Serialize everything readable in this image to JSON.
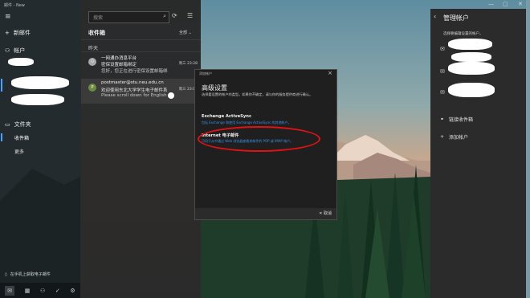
{
  "app": {
    "title": "邮件 - New"
  },
  "sidebar": {
    "menu_icon": "≡",
    "new_mail_label": "新邮件",
    "accounts_label": "帐户",
    "folders_label": "文件夹",
    "inbox_label": "收件箱",
    "more_label": "更多",
    "bottom_message": "在手机上获取电子邮件",
    "bottom_icons": [
      "mail-icon",
      "calendar-icon",
      "people-icon",
      "todo-icon",
      "settings-icon"
    ]
  },
  "message_list": {
    "search_placeholder": "搜索",
    "folder_title": "收件箱",
    "filter_label": "全部",
    "group_label": "昨天",
    "messages": [
      {
        "sender": "一网通办消息平台",
        "subject": "密保设置邮箱绑定",
        "preview": "您好，您正在进行密保设置邮箱绑",
        "time": "周三 23:28",
        "avatar": "person-icon"
      },
      {
        "sender": "postmaster@stu.neu.edu.cn",
        "subject": "欢迎使用东北大学学生电子邮件系",
        "preview": "Please scroll down for English",
        "time": "周三 23:04",
        "avatar": "P"
      }
    ]
  },
  "dialog": {
    "title": "添加帐户",
    "heading": "高级设置",
    "description": "选择要设置的帐户的类型。如果你不确定，请与你的服务提供商进行确认。",
    "options": [
      {
        "name": "Exchange ActiveSync",
        "desc": "包括 Exchange 和使用 Exchange ActiveSync 的其他帐户。"
      },
      {
        "name": "Internet 电子邮件",
        "desc": "可用于从中通过 Web 浏览器查看其邮件的 POP 或 IMAP 帐户。"
      }
    ],
    "cancel_label": "取消"
  },
  "manage_accounts": {
    "title": "管理帐户",
    "description": "选择要编辑设置的帐户。",
    "link_inbox_label": "链接收件箱",
    "add_account_label": "添加帐户"
  },
  "colors": {
    "accent": "#4aa3ff",
    "link": "#3b8fe6",
    "annotation": "#e31212"
  }
}
